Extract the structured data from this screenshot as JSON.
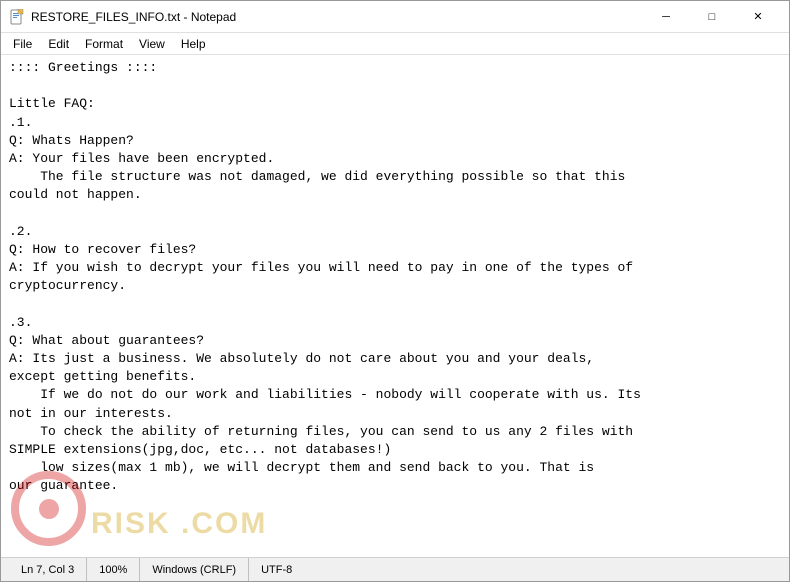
{
  "window": {
    "title": "RESTORE_FILES_INFO.txt - Notepad",
    "icon": "notepad-icon"
  },
  "titlebar": {
    "minimize_label": "─",
    "maximize_label": "□",
    "close_label": "✕"
  },
  "menubar": {
    "items": [
      {
        "label": "File"
      },
      {
        "label": "Edit"
      },
      {
        "label": "Format"
      },
      {
        "label": "View"
      },
      {
        "label": "Help"
      }
    ]
  },
  "editor": {
    "content": ":::: Greetings ::::\n\nLittle FAQ:\n.1.\nQ: Whats Happen?\nA: Your files have been encrypted.\n    The file structure was not damaged, we did everything possible so that this\ncould not happen.\n\n.2.\nQ: How to recover files?\nA: If you wish to decrypt your files you will need to pay in one of the types of\ncryptocurrency.\n\n.3.\nQ: What about guarantees?\nA: Its just a business. We absolutely do not care about you and your deals,\nexcept getting benefits.\n    If we do not do our work and liabilities - nobody will cooperate with us. Its\nnot in our interests.\n    To check the ability of returning files, you can send to us any 2 files with\nSIMPLE extensions(jpg,doc, etc... not databases!)\n    low sizes(max 1 mb), we will decrypt them and send back to you. That is\nour guarantee."
  },
  "statusbar": {
    "position": "Ln 7, Col 3",
    "zoom": "100%",
    "line_ending": "Windows (CRLF)",
    "encoding": "UTF-8"
  }
}
